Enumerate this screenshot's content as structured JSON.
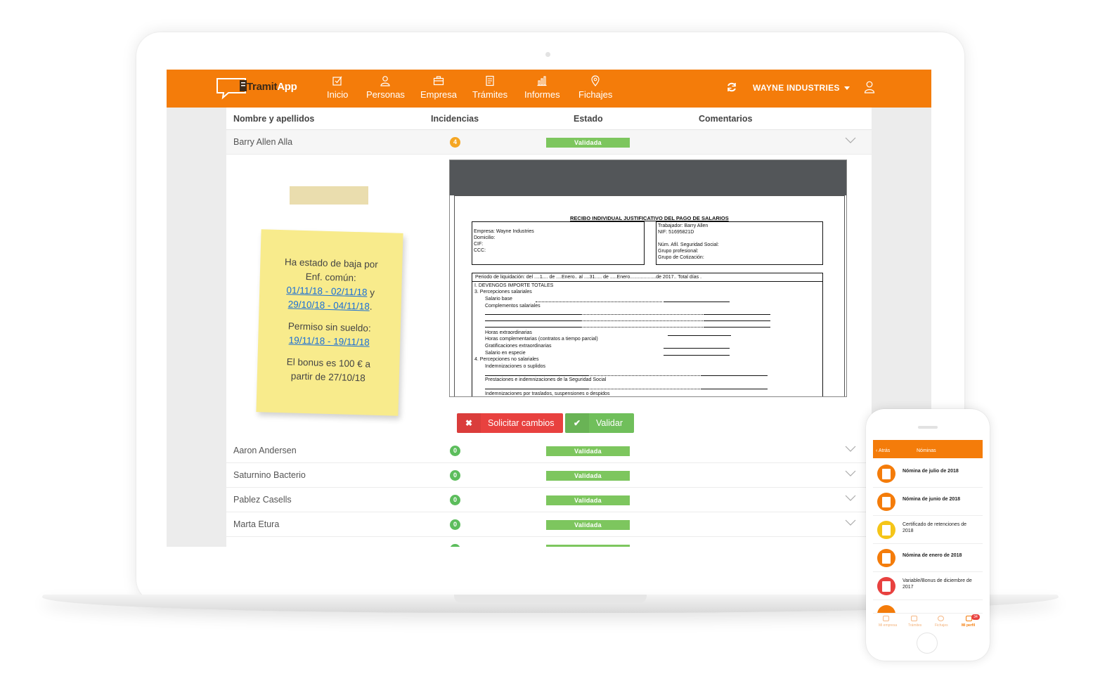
{
  "nav": {
    "brand_prefix": "Tramit",
    "brand_suffix": "App",
    "items": [
      {
        "label": "Inicio",
        "icon": "check-square-icon"
      },
      {
        "label": "Personas",
        "icon": "person-icon"
      },
      {
        "label": "Empresa",
        "icon": "briefcase-icon"
      },
      {
        "label": "Trámites",
        "icon": "document-icon"
      },
      {
        "label": "Informes",
        "icon": "bar-chart-icon"
      },
      {
        "label": "Fichajes",
        "icon": "location-pin-icon"
      }
    ],
    "company": "WAYNE INDUSTRIES",
    "accent_color": "#f47c0a"
  },
  "table": {
    "headers": {
      "name": "Nombre y apellidos",
      "incidents": "Incidencias",
      "status": "Estado",
      "comments": "Comentarios"
    },
    "expanded_row": {
      "name": "Barry Allen Alla",
      "incidents": "4",
      "status": "Validada"
    },
    "rows": [
      {
        "name": "Aaron Andersen",
        "incidents": "0",
        "status": "Validada"
      },
      {
        "name": "Saturnino Bacterio",
        "incidents": "0",
        "status": "Validada"
      },
      {
        "name": "Pablez Casells",
        "incidents": "0",
        "status": "Validada"
      },
      {
        "name": "Marta Etura",
        "incidents": "0",
        "status": "Validada"
      }
    ]
  },
  "note": {
    "line1": "Ha estado de baja por",
    "line2": "Enf. común:",
    "link1": "01/11/18 - 02/11/18",
    "joiner": " y",
    "link2": "29/10/18 - 04/11/18",
    "period": ".",
    "line3": "Permiso sin sueldo:",
    "link3": "19/11/18 - 19/11/18",
    "line4": "El bonus es 100 € a",
    "line5": "partir de 27/10/18"
  },
  "document": {
    "title": "RECIBO INDIVIDUAL JUSTIFICATIVO DEL PAGO DE SALARIOS",
    "company_box": [
      "Empresa: Wayne Industries",
      "Domicilio:",
      "CIF:",
      "CCC:"
    ],
    "worker_box": [
      "Trabajador: Barry Allen",
      "NIF: 51695821D",
      "",
      "Núm. Afil. Seguridad Social:",
      "Grupo profesional:",
      "Grupo de Cotización:"
    ],
    "period": "Periodo de liquidación: del ....1.... de ....Enero.. al ....31..... de .....Enero...................de 2017..  Total días          .",
    "lines": [
      "I. DEVENGOS IMPORTE TOTALES",
      "3.   Percepciones salariales",
      "Salario base",
      "Complementos salariales",
      "Horas extraordinarias",
      "Horas complementarias (contratos a tiempo parcial)",
      "Gratificaciones extraordinarias",
      "Salario en especie",
      "4.   Percepciones no salariales",
      "Indemnizaciones o suplidos",
      "Prestaciones e indemnizaciones de la Seguridad Social",
      "Indemnizaciones por traslados, suspensiones o despidos"
    ]
  },
  "actions": {
    "request_changes": "Solicitar cambios",
    "validate": "Validar",
    "request_icon": "✖",
    "validate_icon": "✔"
  },
  "phone": {
    "back": "Atrás",
    "title": "Nóminas",
    "items": [
      {
        "label": "Nómina de julio de 2018",
        "bold": true,
        "color": "#f47c0a"
      },
      {
        "label": "Nómina de junio de 2018",
        "bold": true,
        "color": "#f47c0a"
      },
      {
        "label": "Certificado de retenciones de 2018",
        "bold": false,
        "color": "#f5c518"
      },
      {
        "label": "Nómina de enero de 2018",
        "bold": true,
        "color": "#f47c0a"
      },
      {
        "label": "Variable/Bonus de diciembre de 2017",
        "bold": false,
        "color": "#e8413f"
      }
    ],
    "tabs": [
      "Mi empresa",
      "Trámites",
      "Fichajes",
      "Mi perfil"
    ],
    "notif_count": "34"
  }
}
